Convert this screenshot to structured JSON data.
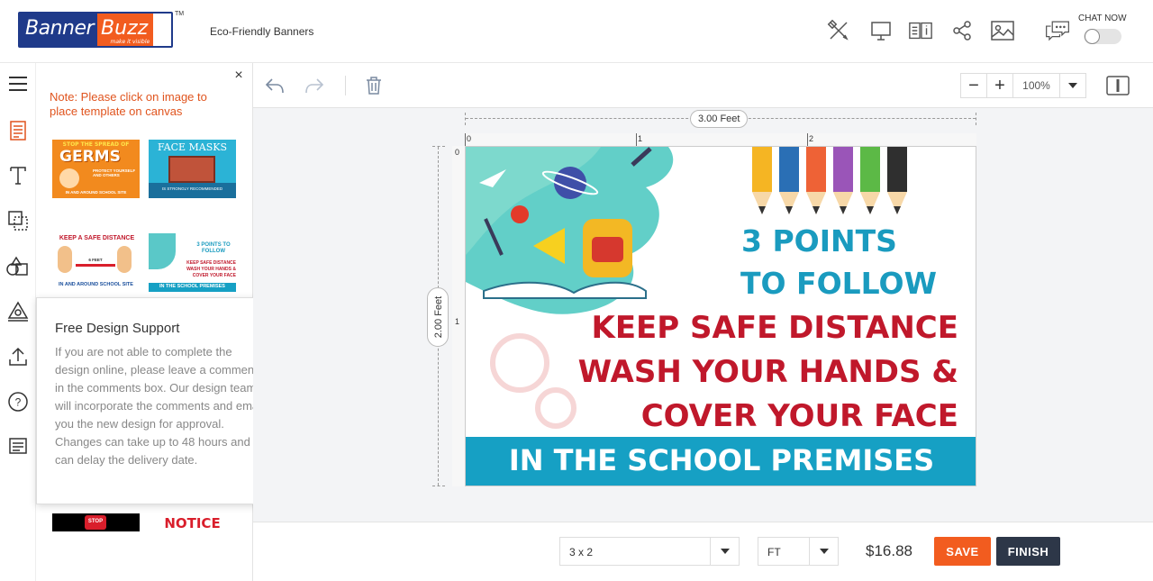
{
  "header": {
    "logo_banner": "Banner",
    "logo_buzz": "Buzz",
    "logo_tagline": "make it visible",
    "logo_tm": "TM",
    "product_name": "Eco-Friendly Banners",
    "icons": [
      "tools-icon",
      "preview-icon",
      "specs-icon",
      "share-icon",
      "image-icon",
      "chat-icon"
    ],
    "chat_label": "CHAT NOW"
  },
  "left_toolbar": {
    "items": [
      "menu-icon",
      "templates-icon",
      "text-icon",
      "layers-icon",
      "shapes-icon",
      "clipart-icon",
      "upload-icon",
      "help-icon",
      "comments-icon"
    ]
  },
  "template_panel": {
    "close": "×",
    "note": "Note: Please click on image to place template on canvas",
    "templates": [
      {
        "title": "STOP THE SPREAD OF",
        "big": "GERMS",
        "sub": "PROTECT YOURSELF AND OTHERS",
        "footer": "IN AND AROUND SCHOOL SITE",
        "bg": "#f28a1e"
      },
      {
        "title": "FACE MASKS",
        "footer": "IS STRONGLY RECOMMENDED",
        "bg": "#2bb3d6"
      },
      {
        "title": "KEEP A SAFE DISTANCE",
        "sub": "6 FEET",
        "footer": "IN AND AROUND SCHOOL SITE",
        "bg": "#ffffff"
      },
      {
        "title": "3 POINTS TO FOLLOW",
        "sub": "KEEP SAFE DISTANCE",
        "footer": "IN THE SCHOOL PREMISES",
        "bg": "#ffffff"
      },
      {
        "title": "STOP",
        "bg": "#000000"
      },
      {
        "title": "NOTICE",
        "bg": "#ffffff"
      }
    ]
  },
  "popup": {
    "title": "Free Design Support",
    "close": "×",
    "body": "If you are not able to complete the design online, please leave a comments in the comments box. Our design team will incorporate the comments and email you the new design for approval. Changes can take up to 48 hours and can delay the delivery date."
  },
  "canvas_toolbar": {
    "zoom_minus": "−",
    "zoom_plus": "+",
    "zoom_value": "100%"
  },
  "canvas": {
    "width_label": "3.00 Feet",
    "height_label": "2.00 Feet",
    "ruler_h": [
      "0",
      "1",
      "2"
    ],
    "ruler_v": [
      "0",
      "1"
    ]
  },
  "banner": {
    "line1": "3 POINTS",
    "line2": "TO FOLLOW",
    "line3": "KEEP SAFE DISTANCE",
    "line4": "WASH YOUR HANDS &",
    "line5": "COVER YOUR FACE",
    "footer": "IN THE SCHOOL PREMISES",
    "colors": {
      "teal": "#1a9bbf",
      "red": "#c0182b",
      "band": "#16a0c4"
    }
  },
  "bottom_bar": {
    "size_value": "3 x 2",
    "unit_value": "FT",
    "price": "$16.88",
    "save_label": "SAVE",
    "finish_label": "FINISH",
    "save_color": "#f25c1f",
    "finish_color": "#2d3748"
  }
}
